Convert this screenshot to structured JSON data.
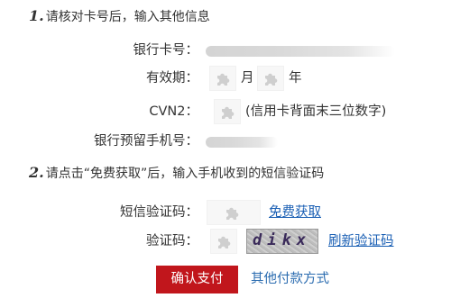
{
  "step1": {
    "num": "1.",
    "text": "请核对卡号后，输入其他信息"
  },
  "step2": {
    "num": "2.",
    "text": "请点击“免费获取”后，输入手机收到的短信验证码"
  },
  "card": {
    "label": "银行卡号：",
    "value_icon": "masked-text"
  },
  "expiry": {
    "label": "有效期：",
    "month_unit": "月",
    "year_unit": "年",
    "icon": "puzzle-placeholder-icon"
  },
  "cvn": {
    "label": "CVN2：",
    "hint": "(信用卡背面末三位数字)",
    "icon": "puzzle-placeholder-icon"
  },
  "phone": {
    "label": "银行预留手机号：",
    "value_icon": "masked-text"
  },
  "sms": {
    "label": "短信验证码：",
    "get_link": "免费获取",
    "icon": "puzzle-placeholder-icon"
  },
  "captcha": {
    "label": "验证码：",
    "image_text": "dikx",
    "refresh_link": "刷新验证码",
    "icon": "puzzle-placeholder-icon"
  },
  "actions": {
    "confirm_label": "确认支付",
    "other_label": "其他付款方式"
  },
  "colors": {
    "confirm_bg": "#c1161c",
    "link": "#1a5fb4",
    "text": "#333333"
  }
}
